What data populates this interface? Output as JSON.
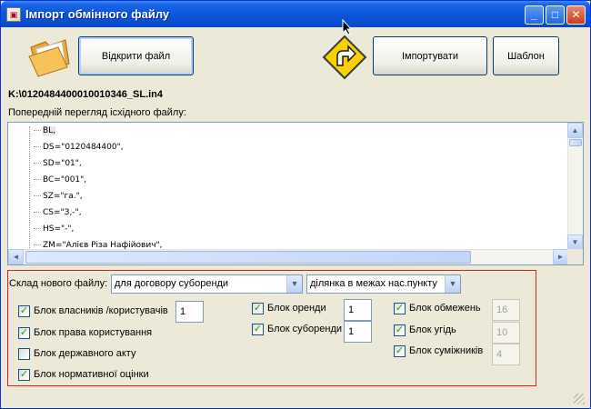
{
  "window": {
    "title": "Імпорт обмінного файлу",
    "min_label": "_",
    "max_label": "□",
    "close_label": "✕"
  },
  "toolbar": {
    "open_label": "Відкрити файл",
    "import_label": "Імпортувати",
    "template_label": "Шаблон"
  },
  "file_path": "K:\\0120484400010010346_SL.in4",
  "preview": {
    "label": "Попередній перегляд іс­хідного файлу:",
    "lines": [
      "BL,",
      "DS=\"0120484400\",",
      "SD=\"01\",",
      "BC=\"001\",",
      "SZ=\"га.\",",
      "CS=\"З,-\",",
      "HS=\"-\",",
      "ZM=\"Аліє­в Різа Нафійович\","
    ]
  },
  "composition": {
    "label": "Склад нового файлу:",
    "contract_select": "для договору суборенди",
    "area_select": "ділянка в межах нас.пункту"
  },
  "blocks": {
    "owners": {
      "label": "Блок власників /користувачів",
      "checked": true,
      "value": "1"
    },
    "rights": {
      "label": "Блок права користування",
      "checked": true
    },
    "state_act": {
      "label": "Блок державного акту",
      "checked": false
    },
    "normative": {
      "label": "Блок нормативної оцінки",
      "checked": true
    },
    "lease": {
      "label": "Блок оренди",
      "checked": true,
      "value": "1"
    },
    "sublease": {
      "label": "Блок суборенди",
      "checked": true,
      "value": "1"
    },
    "restrictions": {
      "label": "Блок обмежень",
      "checked": true,
      "value": "16"
    },
    "agreements": {
      "label": "Блок угідь",
      "checked": true,
      "value": "10"
    },
    "neighbors": {
      "label": "Блок суміжників",
      "checked": true,
      "value": "4"
    }
  },
  "colors": {
    "titlebar": "#0a56dc",
    "highlight_border": "#e02020",
    "check": "#21a121"
  }
}
